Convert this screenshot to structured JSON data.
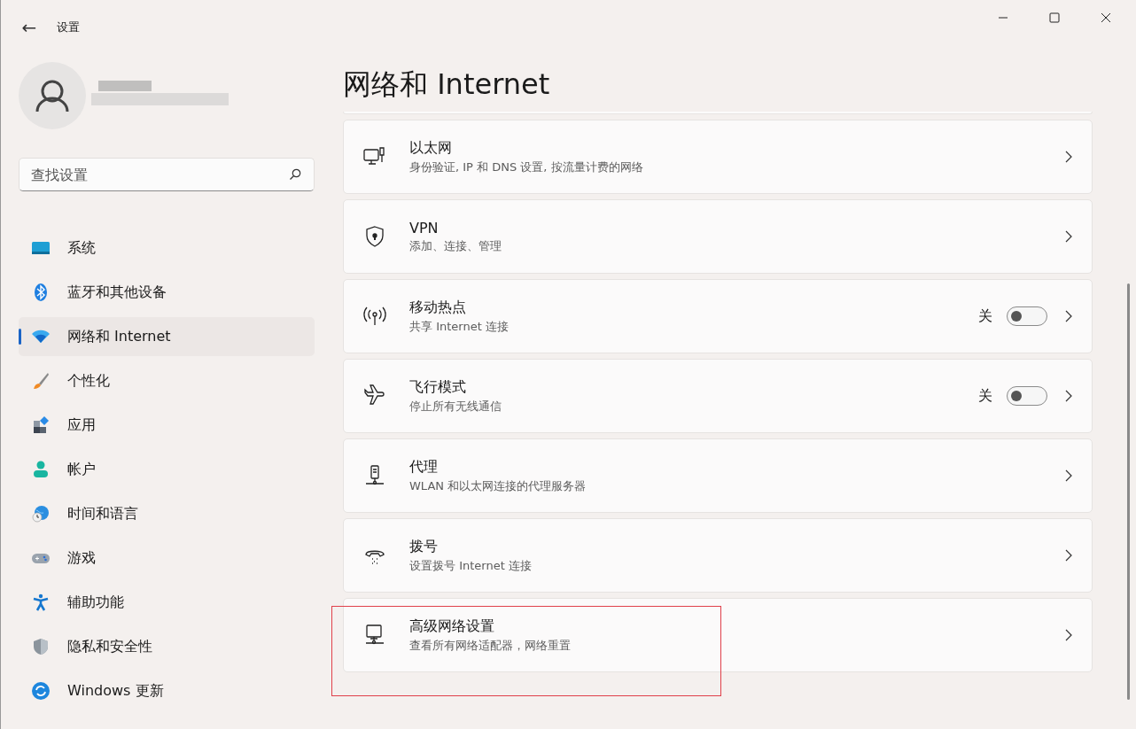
{
  "window": {
    "title": "设置",
    "back": "←"
  },
  "search": {
    "placeholder": "查找设置"
  },
  "sidebar": {
    "items": [
      {
        "label": "系统",
        "selected": false
      },
      {
        "label": "蓝牙和其他设备",
        "selected": false
      },
      {
        "label": "网络和 Internet",
        "selected": true
      },
      {
        "label": "个性化",
        "selected": false
      },
      {
        "label": "应用",
        "selected": false
      },
      {
        "label": "帐户",
        "selected": false
      },
      {
        "label": "时间和语言",
        "selected": false
      },
      {
        "label": "游戏",
        "selected": false
      },
      {
        "label": "辅助功能",
        "selected": false
      },
      {
        "label": "隐私和安全性",
        "selected": false
      },
      {
        "label": "Windows 更新",
        "selected": false
      }
    ]
  },
  "page": {
    "title": "网络和 Internet",
    "items": [
      {
        "kind": "link",
        "title": "以太网",
        "subtitle": "身份验证, IP 和 DNS 设置, 按流量计费的网络",
        "highlighted": false
      },
      {
        "kind": "link",
        "title": "VPN",
        "subtitle": "添加、连接、管理",
        "highlighted": false
      },
      {
        "kind": "toggle",
        "title": "移动热点",
        "subtitle": "共享 Internet 连接",
        "state_label": "关",
        "on": false,
        "highlighted": false
      },
      {
        "kind": "toggle",
        "title": "飞行模式",
        "subtitle": "停止所有无线通信",
        "state_label": "关",
        "on": false,
        "highlighted": false
      },
      {
        "kind": "link",
        "title": "代理",
        "subtitle": "WLAN 和以太网连接的代理服务器",
        "highlighted": false
      },
      {
        "kind": "link",
        "title": "拨号",
        "subtitle": "设置拨号 Internet 连接",
        "highlighted": false
      },
      {
        "kind": "link",
        "title": "高级网络设置",
        "subtitle": "查看所有网络适配器，网络重置",
        "highlighted": true
      }
    ]
  }
}
